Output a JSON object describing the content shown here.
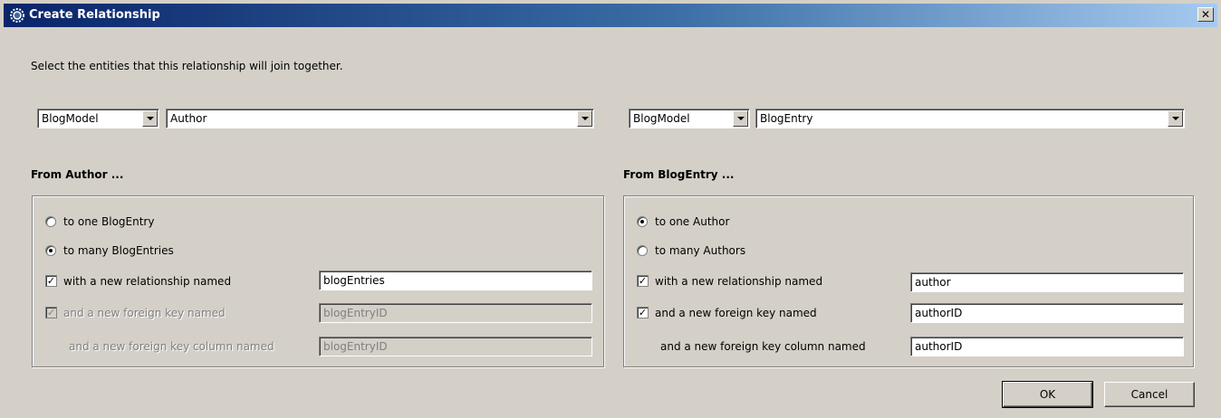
{
  "window": {
    "title": "Create Relationship",
    "close_glyph": "✕"
  },
  "instruction": "Select the entities that this relationship will join together.",
  "left": {
    "model_select": "BlogModel",
    "entity_select": "Author",
    "section_title": "From Author ...",
    "option_one": "to one BlogEntry",
    "option_many": "to many BlogEntries",
    "option_one_selected": false,
    "option_many_selected": true,
    "relationship_check_label": "with a new relationship named",
    "relationship_checked": true,
    "relationship_name": "blogEntries",
    "fk_check_label": "and a new foreign key named",
    "fk_checked": true,
    "fk_disabled": true,
    "fk_name": "blogEntryID",
    "fk_column_label": "and a new foreign key column named",
    "fk_column_name": "blogEntryID"
  },
  "right": {
    "model_select": "BlogModel",
    "entity_select": "BlogEntry",
    "section_title": "From BlogEntry ...",
    "option_one": "to one Author",
    "option_many": "to many Authors",
    "option_one_selected": true,
    "option_many_selected": false,
    "relationship_check_label": "with a new relationship named",
    "relationship_checked": true,
    "relationship_name": "author",
    "fk_check_label": "and a new foreign key named",
    "fk_checked": true,
    "fk_name": "authorID",
    "fk_column_label": "and a new foreign key column named",
    "fk_column_name": "authorID"
  },
  "buttons": {
    "ok": "OK",
    "cancel": "Cancel"
  },
  "colors": {
    "title_start": "#0a246a",
    "title_end": "#a6caf0",
    "dialog_bg": "#d4d0c8"
  }
}
